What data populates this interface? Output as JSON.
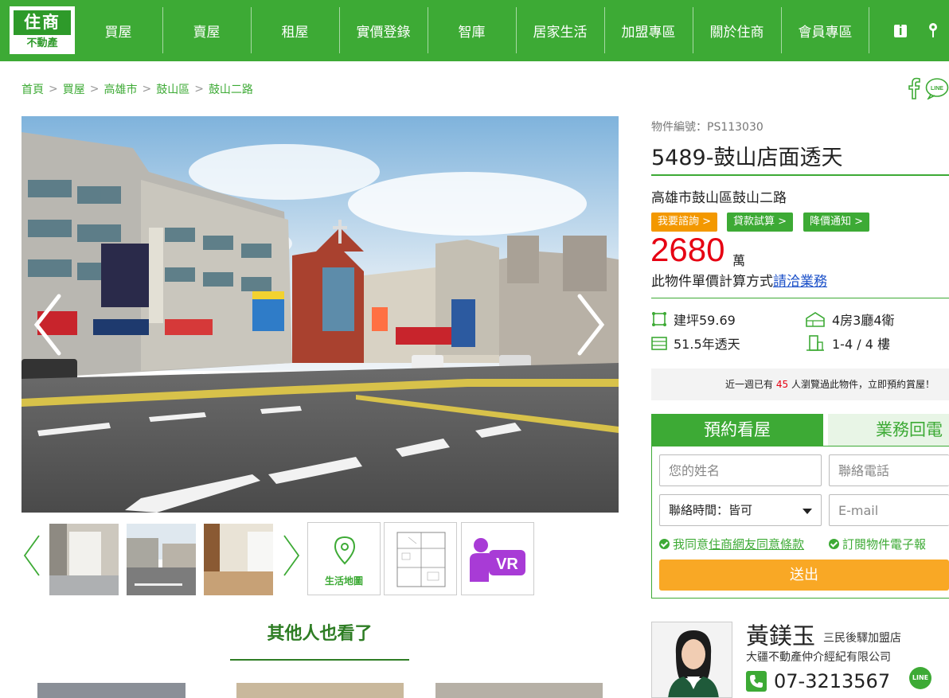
{
  "brand": {
    "logo_top": "住商",
    "logo_bottom": "不動產"
  },
  "nav": [
    "買屋",
    "賣屋",
    "租屋",
    "實價登錄",
    "智庫",
    "居家生活",
    "加盟專區",
    "關於住商",
    "會員專區"
  ],
  "header_icons": [
    "info-icon",
    "location-pin-icon"
  ],
  "breadcrumb": [
    "首頁",
    "買屋",
    "高雄市",
    "鼓山區",
    "鼓山二路"
  ],
  "share": {
    "facebook": "f",
    "line": "LINE"
  },
  "listing": {
    "object_no": "物件編號：PS113030",
    "title": "5489-鼓山店面透天",
    "address": "高雄市鼓山區鼓山二路",
    "actions": [
      "我要諮詢",
      "貸款試算",
      "降價通知"
    ],
    "price": "2680",
    "price_unit": "萬",
    "unit_price_text": "此物件單價計算方式",
    "unit_price_link": "請洽業務",
    "specs": {
      "area": "建坪59.69",
      "layout": "4房3廳4衛",
      "age": "51.5年透天",
      "floor": "1-4 / 4 樓"
    },
    "views_prefix": "近一週已有",
    "views_count": "45",
    "views_suffix": "人瀏覽過此物件，立即預約賞屋！"
  },
  "gallery": {
    "tiles": [
      "生活地圖",
      "",
      "VR"
    ]
  },
  "others": {
    "title": "其他人也看了"
  },
  "form": {
    "tab_active": "預約看屋",
    "tab_inactive": "業務回電",
    "name_placeholder": "您的姓名",
    "phone_placeholder": "聯絡電話",
    "time_label": "聯絡時間：皆可",
    "email_placeholder": "E-mail",
    "agree_prefix": "我同意",
    "agree_link": "住商網友同意條款",
    "subscribe": "訂閱物件電子報",
    "submit": "送出"
  },
  "agent": {
    "name": "黃鎂玉",
    "store": "三民後驛加盟店",
    "company": "大疆不動產仲介經紀有限公司",
    "phone": "07-3213567"
  },
  "colors": {
    "brand_green": "#3daa35",
    "price_red": "#e60012",
    "submit_orange": "#f9a825",
    "pill_orange": "#f39800"
  }
}
